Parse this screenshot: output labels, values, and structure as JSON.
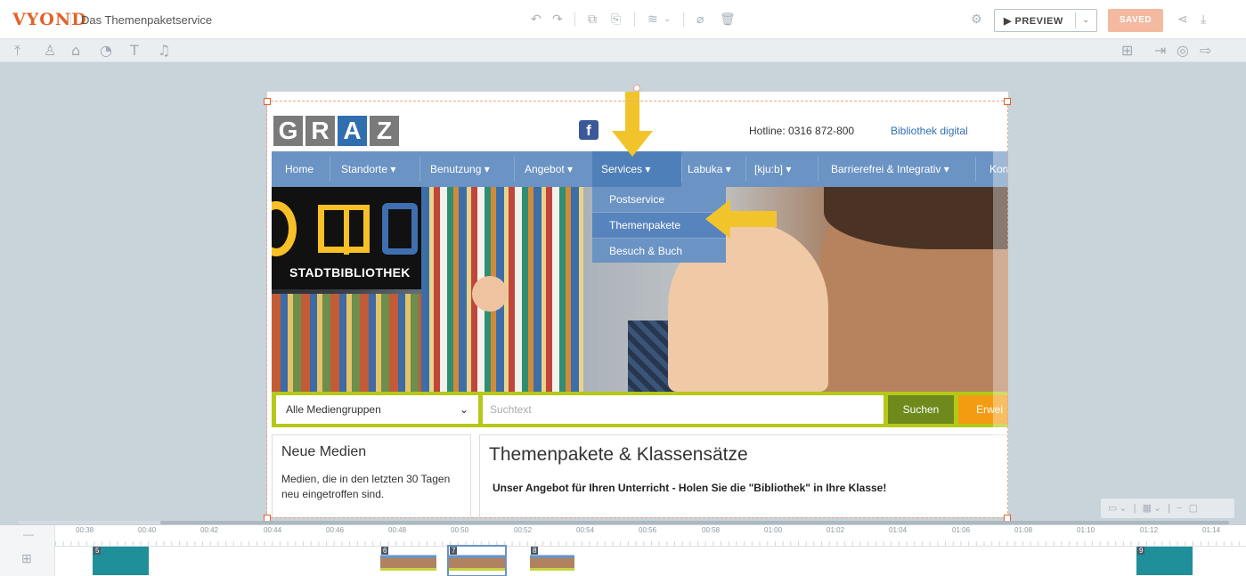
{
  "app": {
    "logo_text": "VYOND",
    "document_title": "Das Themenpaketservice",
    "preview_label": "PREVIEW",
    "saved_label": "SAVED"
  },
  "toolbar_icons": [
    "upload-icon",
    "character-icon",
    "prop-icon",
    "chart-icon",
    "text-icon",
    "audio-icon"
  ],
  "site": {
    "logo_letters": [
      "G",
      "R",
      "A",
      "Z"
    ],
    "facebook_label": "f",
    "hotline": "Hotline: 0316 872-800",
    "bib_link": "Bibliothek digital",
    "nav": [
      "Home",
      "Standorte ▾",
      "Benutzung ▾",
      "Angebot ▾",
      "Services ▾",
      "Labuka ▾",
      "[kju:b] ▾",
      "Barrierefrei & Integrativ ▾",
      "Kon"
    ],
    "active_nav_index": 4,
    "dropdown": [
      "Postservice",
      "Themenpakete",
      "Besuch & Buch"
    ],
    "hero_brand": "STADTBIBLIOTHEK",
    "search": {
      "select_value": "Alle Mediengruppen",
      "placeholder": "Suchtext",
      "button": "Suchen",
      "extended": "Erwei"
    },
    "left_box": {
      "title": "Neue Medien",
      "text": "Medien, die in den letzten 30 Tagen neu eingetroffen sind."
    },
    "main_box": {
      "title": "Themenpakete & Klassensätze",
      "subtitle": "Unser Angebot für Ihren Unterricht - Holen Sie die \"Bibliothek\" in Ihre Klasse!"
    }
  },
  "timeline": {
    "ticks": [
      "00:38",
      "00:40",
      "00:42",
      "00:44",
      "00:46",
      "00:48",
      "00:50",
      "00:52",
      "00:54",
      "00:56",
      "00:58",
      "01:00",
      "01:02",
      "01:04",
      "01:06",
      "01:08",
      "01:10",
      "01:12",
      "01:14"
    ],
    "scenes": [
      "5",
      "6",
      "7",
      "8",
      "9"
    ]
  },
  "colors": {
    "accent": "#e3622a",
    "nav_blue": "#6b93c4",
    "search_green": "#b5c818",
    "arrow_yellow": "#f2c42c"
  }
}
